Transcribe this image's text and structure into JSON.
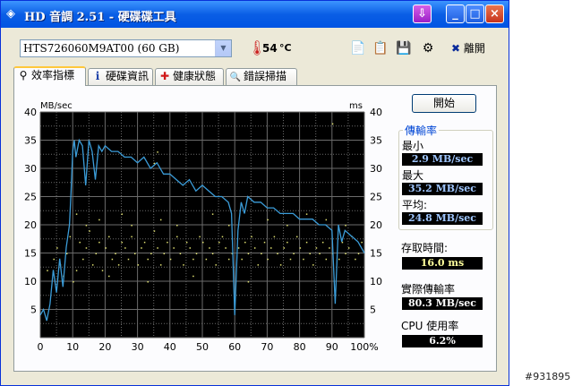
{
  "window": {
    "title": "HD 音調 2.51 - 硬碟碟工具",
    "tray_label": "⇩",
    "min_label": "_",
    "max_label": "□",
    "close_label": "×"
  },
  "toolbar": {
    "drive": "HTS726060M9AT00 (60 GB)",
    "temperature": "54",
    "temp_unit": "°C",
    "exit_label": "離開",
    "exit_mark": "✖"
  },
  "tabs": [
    {
      "label": "效率指標",
      "icon": "gauge-icon",
      "glyph": "⚲"
    },
    {
      "label": "硬碟資訊",
      "icon": "info-icon",
      "glyph": "i"
    },
    {
      "label": "健康狀態",
      "icon": "health-cross-icon",
      "glyph": "✚"
    },
    {
      "label": "錯誤掃描",
      "icon": "magnifier-icon",
      "glyph": "🔍"
    }
  ],
  "start_label": "開始",
  "stats": {
    "group_title": "傳輸率",
    "min_label": "最小",
    "min_value": "2.9 MB/sec",
    "max_label": "最大",
    "max_value": "35.2 MB/sec",
    "avg_label": "平均:",
    "avg_value": "24.8 MB/sec",
    "access_label": "存取時間:",
    "access_value": "16.0 ms",
    "burst_label": "實際傳輸率",
    "burst_value": "80.3 MB/sec",
    "cpu_label": "CPU 使用率",
    "cpu_value": "6.2%"
  },
  "watermark": "#931895",
  "colors": {
    "line": "#3b9cd8",
    "dots": "#e0e070",
    "grid": "#6b6b6b",
    "plot_bg": "#000000"
  },
  "chart_data": {
    "type": "line",
    "ylabel_left": "MB/sec",
    "ylabel_right": "ms",
    "xlim": [
      0,
      100
    ],
    "ylim": [
      0,
      40
    ],
    "x_ticks": [
      "0",
      "10",
      "20",
      "30",
      "40",
      "50",
      "60",
      "70",
      "80",
      "90",
      "100%"
    ],
    "y_ticks": [
      "5",
      "10",
      "15",
      "20",
      "25",
      "30",
      "35",
      "40"
    ],
    "grid": true,
    "series": [
      {
        "values_x": [
          0,
          1,
          2,
          3,
          4,
          5,
          6,
          7,
          8,
          9,
          9.5,
          10,
          10.5,
          11,
          12,
          13,
          14,
          15,
          16,
          17,
          18,
          19,
          20,
          22,
          24,
          26,
          28,
          30,
          32,
          34,
          36,
          38,
          40,
          42,
          44,
          46,
          48,
          50,
          52,
          54,
          56,
          58,
          59,
          60,
          61,
          62,
          63,
          64,
          66,
          68,
          70,
          72,
          74,
          76,
          78,
          80,
          82,
          84,
          86,
          88,
          90,
          91,
          92,
          93,
          94,
          96,
          98,
          100
        ],
        "values_y": [
          4,
          5,
          3,
          6,
          12,
          8,
          14,
          9,
          16,
          20,
          26,
          33,
          35,
          32,
          35,
          34,
          27,
          35,
          33,
          28,
          34,
          33,
          34,
          33,
          33,
          32,
          32,
          31,
          32,
          30,
          31,
          29,
          29,
          28,
          27,
          28,
          26,
          27,
          26,
          25,
          25,
          24,
          22,
          4,
          19,
          24,
          22,
          25,
          24,
          24,
          23,
          23,
          22,
          22,
          22,
          21,
          21,
          21,
          20,
          20,
          19,
          6,
          20,
          17,
          19,
          18,
          17,
          15
        ]
      },
      {
        "type": "scatter",
        "values_x": [
          2,
          4,
          5,
          6,
          7,
          8,
          9,
          11,
          12,
          13,
          14,
          15,
          16,
          17,
          18,
          19,
          20,
          21,
          22,
          23,
          24,
          25,
          26,
          27,
          28,
          29,
          30,
          31,
          32,
          33,
          34,
          35,
          36,
          37,
          38,
          39,
          40,
          41,
          42,
          43,
          44,
          45,
          46,
          47,
          48,
          49,
          50,
          51,
          52,
          53,
          54,
          55,
          56,
          57,
          58,
          59,
          61,
          62,
          63,
          64,
          65,
          66,
          67,
          68,
          69,
          70,
          71,
          72,
          73,
          74,
          75,
          76,
          77,
          78,
          79,
          80,
          81,
          82,
          83,
          84,
          85,
          86,
          87,
          88,
          89,
          90,
          92,
          93,
          94,
          95,
          96,
          97,
          98,
          99,
          10,
          11,
          14,
          18,
          21,
          25,
          28,
          33,
          37,
          42,
          47,
          53,
          58,
          64,
          70,
          76,
          82,
          88,
          94,
          35,
          36,
          90
        ],
        "values_y": [
          12,
          14,
          16,
          13,
          11,
          15,
          18,
          12,
          17,
          14,
          16,
          19,
          13,
          15,
          17,
          12,
          16,
          18,
          14,
          15,
          13,
          17,
          16,
          14,
          18,
          15,
          13,
          16,
          17,
          14,
          15,
          19,
          16,
          13,
          15,
          17,
          14,
          16,
          18,
          15,
          13,
          17,
          16,
          14,
          15,
          18,
          17,
          14,
          16,
          15,
          13,
          17,
          18,
          16,
          14,
          15,
          16,
          14,
          17,
          15,
          18,
          16,
          13,
          15,
          17,
          14,
          16,
          18,
          15,
          13,
          16,
          17,
          14,
          15,
          18,
          16,
          14,
          17,
          15,
          13,
          16,
          15,
          17,
          14,
          16,
          15,
          14,
          17,
          15,
          16,
          18,
          14,
          15,
          17,
          10,
          22,
          20,
          21,
          11,
          22,
          20,
          10,
          21,
          20,
          11,
          22,
          20,
          10,
          21,
          20,
          22,
          21,
          20,
          31,
          33,
          38
        ]
      }
    ]
  }
}
